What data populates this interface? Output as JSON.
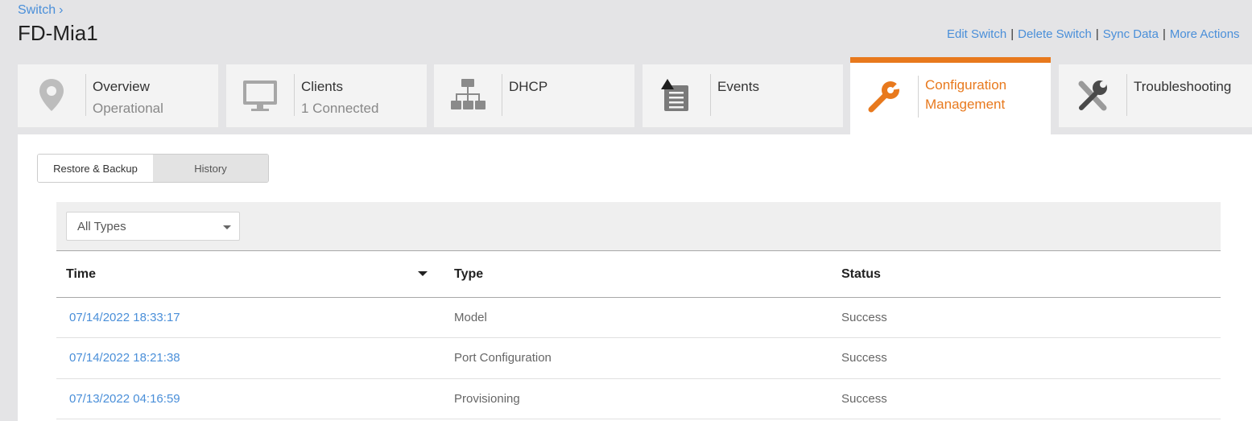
{
  "breadcrumb": {
    "label": "Switch",
    "chevron": "›"
  },
  "page_title": "FD-Mia1",
  "actions": {
    "edit": "Edit Switch",
    "delete": "Delete Switch",
    "sync": "Sync Data",
    "more": "More Actions",
    "separator": "|"
  },
  "tabs": [
    {
      "icon": "location-pin-icon",
      "label": "Overview",
      "sub": "Operational"
    },
    {
      "icon": "monitor-icon",
      "label": "Clients",
      "sub": "1 Connected"
    },
    {
      "icon": "network-tree-icon",
      "label": "DHCP",
      "sub": ""
    },
    {
      "icon": "events-doc-icon",
      "label": "Events",
      "sub": ""
    },
    {
      "icon": "wrench-icon",
      "label": "Configuration Management",
      "sub": "",
      "active": true
    },
    {
      "icon": "tools-icon",
      "label": "Troubleshooting",
      "sub": ""
    }
  ],
  "subtabs": {
    "restore": "Restore & Backup",
    "history": "History",
    "selected": "Restore & Backup"
  },
  "filter": {
    "selected": "All Types"
  },
  "table": {
    "columns": [
      "Time",
      "Type",
      "Status"
    ],
    "sort": {
      "column": "Time",
      "direction": "descending"
    },
    "rows": [
      {
        "time": "07/14/2022 18:33:17",
        "type": "Model",
        "status": "Success"
      },
      {
        "time": "07/14/2022 18:21:38",
        "type": "Port Configuration",
        "status": "Success"
      },
      {
        "time": "07/13/2022 04:16:59",
        "type": "Provisioning",
        "status": "Success"
      }
    ]
  },
  "colors": {
    "accent": "#e8791d",
    "link": "#4a8fd9",
    "icon_gray": "#9a9a9a",
    "icon_dark": "#4a4a4a"
  }
}
